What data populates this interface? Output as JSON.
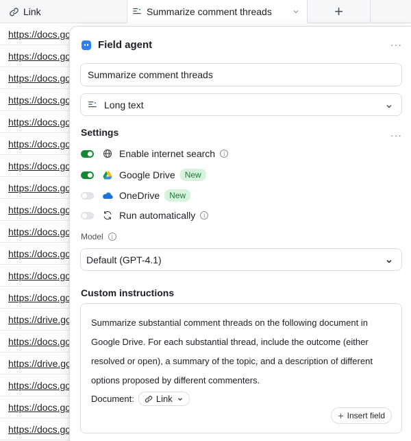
{
  "grid": {
    "columns": [
      {
        "label": "Link",
        "icon": "link-icon"
      },
      {
        "label": "Summarize comment threads",
        "icon": "long-text-icon"
      },
      {
        "label": "+",
        "icon": "plus-icon"
      }
    ],
    "rows": [
      "https://docs.go",
      "https://docs.go",
      "https://docs.go",
      "https://docs.go",
      "https://docs.go",
      "https://docs.go",
      "https://docs.go",
      "https://docs.go",
      "https://docs.go",
      "https://docs.go",
      "https://docs.go",
      "https://docs.go",
      "https://docs.go",
      "https://drive.go",
      "https://docs.go",
      "https://drive.go",
      "https://docs.go",
      "https://docs.go",
      "https://docs.go"
    ]
  },
  "panel": {
    "title": "Field agent",
    "more": "···",
    "field_name": "Summarize comment threads",
    "field_type": "Long text",
    "settings_label": "Settings",
    "settings": [
      {
        "label": "Enable internet search",
        "on": true,
        "icon": "globe-icon",
        "info": true
      },
      {
        "label": "Google Drive",
        "on": true,
        "icon": "google-drive-icon",
        "badge": "New"
      },
      {
        "label": "OneDrive",
        "on": false,
        "icon": "onedrive-icon",
        "badge": "New"
      },
      {
        "label": "Run automatically",
        "on": false,
        "icon": "refresh-icon",
        "info": true
      }
    ],
    "model_label": "Model",
    "model_value": "Default (GPT-4.1)",
    "custom_instructions_label": "Custom instructions",
    "instructions": "Summarize substantial comment threads on the following document in Google Drive. For each substantial thread, include the outcome (either resolved or open), a summary of the topic, and a description of different options proposed by different commenters.",
    "document_label": "Document:",
    "document_chip": "Link",
    "insert_field": "Insert field"
  },
  "colors": {
    "accent": "#2d7ff9",
    "toggle_on": "#138a32",
    "badge_bg": "#d8f3dc",
    "badge_text": "#1a7a3a"
  }
}
